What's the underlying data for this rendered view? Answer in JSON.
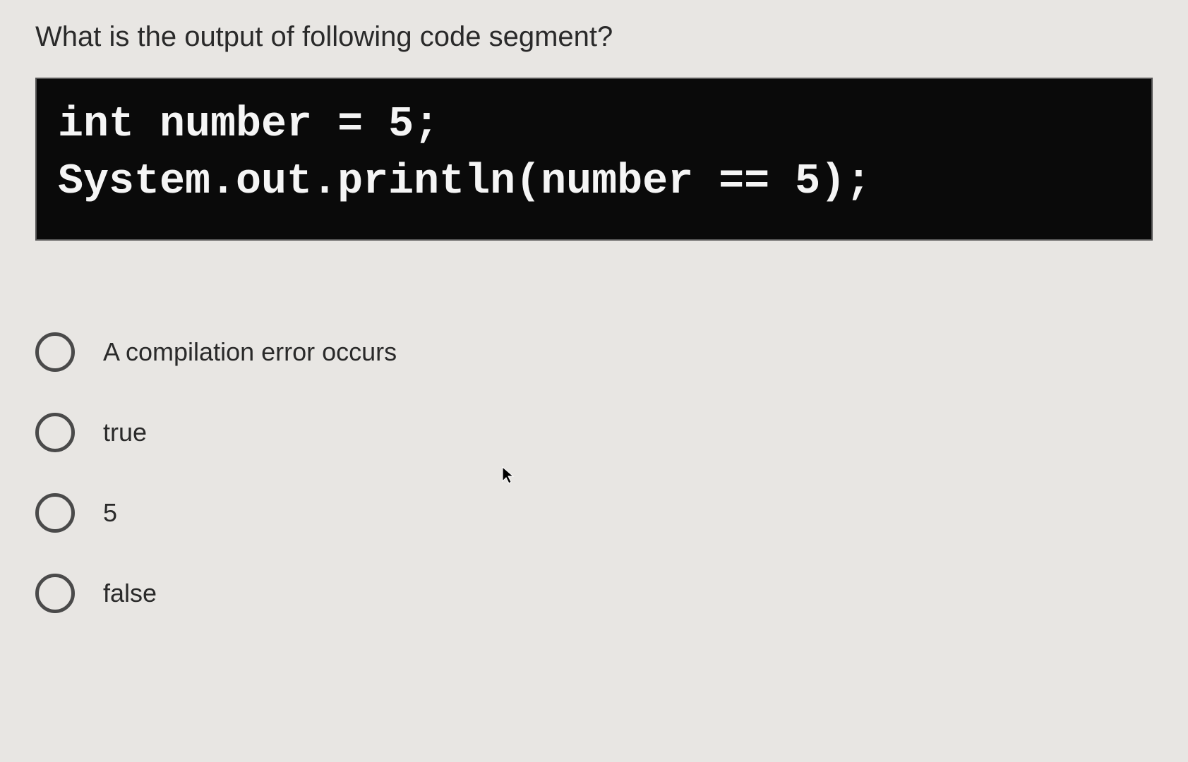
{
  "question": {
    "prompt": "What is the output of following code segment?",
    "code": "int number = 5;\nSystem.out.println(number == 5);"
  },
  "options": [
    {
      "label": "A compilation error occurs"
    },
    {
      "label": "true"
    },
    {
      "label": "5"
    },
    {
      "label": "false"
    }
  ]
}
